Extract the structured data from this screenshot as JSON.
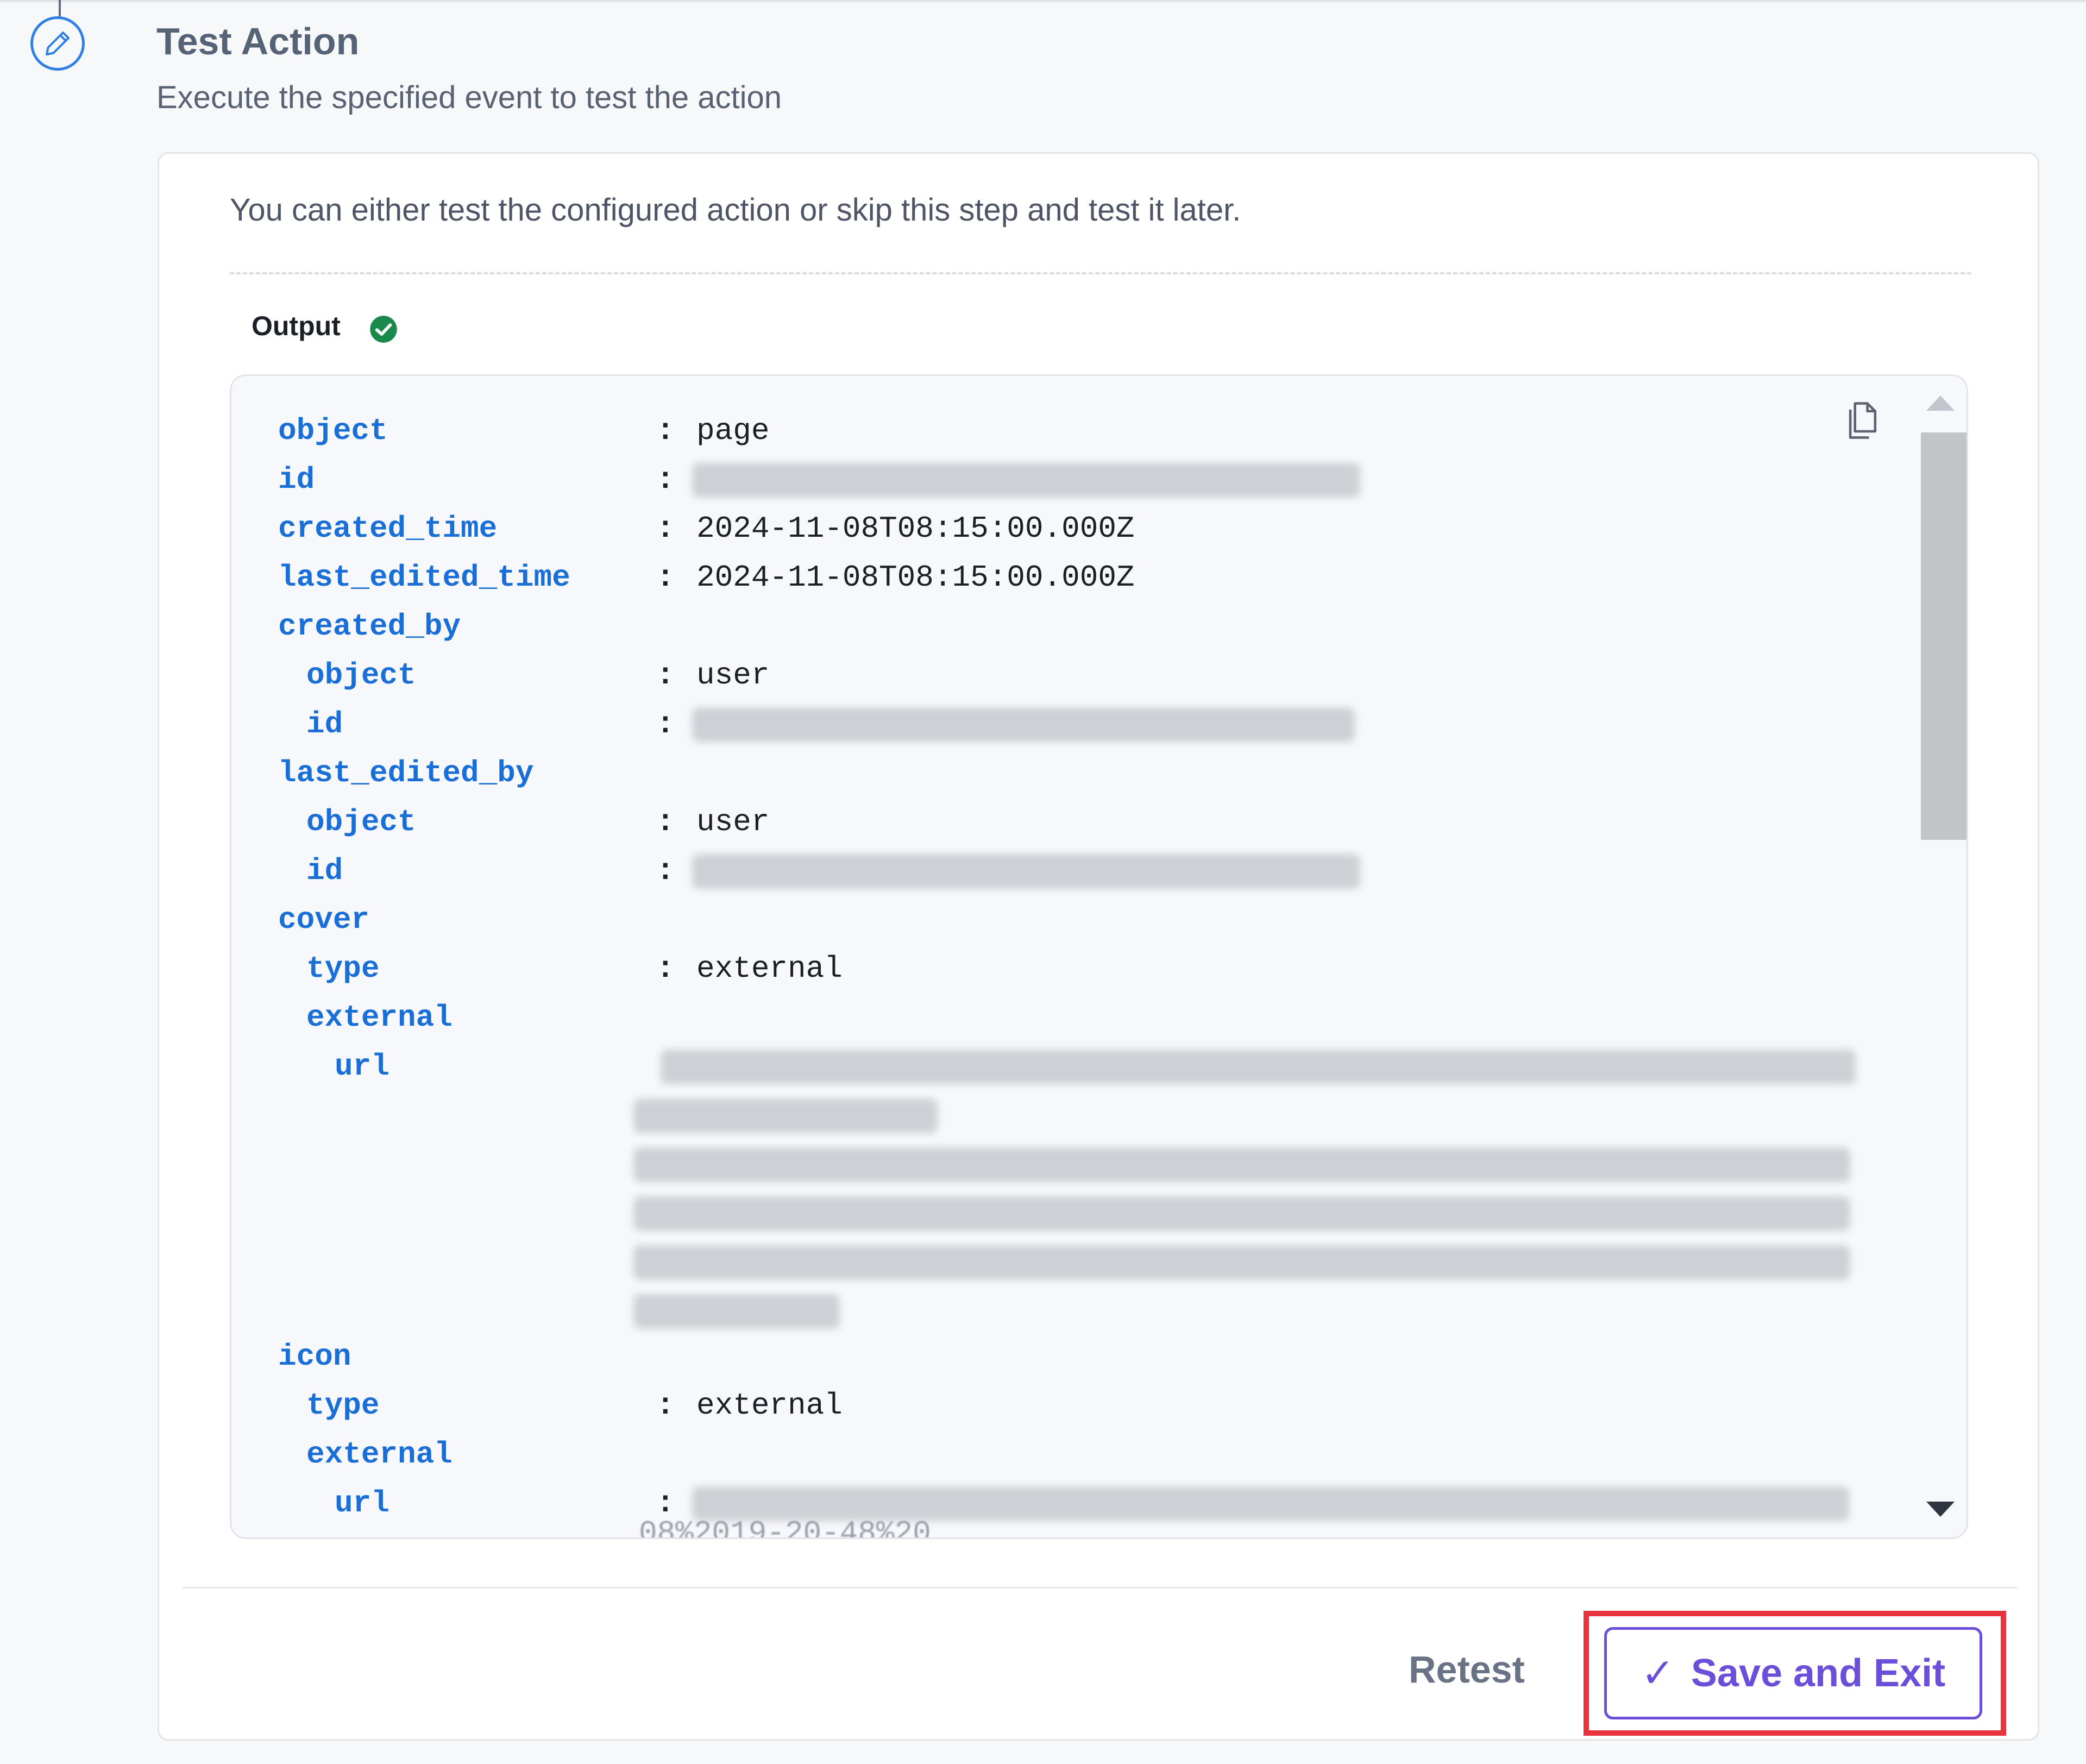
{
  "step": {
    "title": "Test Action",
    "subtitle": "Execute the specified event to test the action",
    "icon": "pencil-icon"
  },
  "card": {
    "intro": "You can either test the configured action or skip this step and test it later.",
    "output_label": "Output",
    "output_status_icon": "check-circle-icon"
  },
  "output": {
    "rows": [
      {
        "key": "object",
        "value": "page"
      },
      {
        "key": "id",
        "value": ""
      },
      {
        "key": "created_time",
        "value": "2024-11-08T08:15:00.000Z"
      },
      {
        "key": "last_edited_time",
        "value": "2024-11-08T08:15:00.000Z"
      },
      {
        "key": "created_by"
      },
      {
        "key": "object",
        "value": "user"
      },
      {
        "key": "id",
        "value": ""
      },
      {
        "key": "last_edited_by"
      },
      {
        "key": "object",
        "value": "user"
      },
      {
        "key": "id",
        "value": ""
      },
      {
        "key": "cover"
      },
      {
        "key": "type",
        "value": "external"
      },
      {
        "key": "external"
      },
      {
        "key": "url",
        "value": ""
      },
      {
        "key": "icon"
      },
      {
        "key": "type",
        "value": "external"
      },
      {
        "key": "external"
      },
      {
        "key": "url",
        "value": ""
      }
    ],
    "separator": ":",
    "partial_text": "08%2019-20-48%20"
  },
  "footer": {
    "retest_label": "Retest",
    "save_label": "Save and Exit"
  },
  "colors": {
    "key": "#1a6fd6",
    "accent": "#6b4fd8",
    "highlight": "#e8343e",
    "success": "#1a8a4a"
  }
}
